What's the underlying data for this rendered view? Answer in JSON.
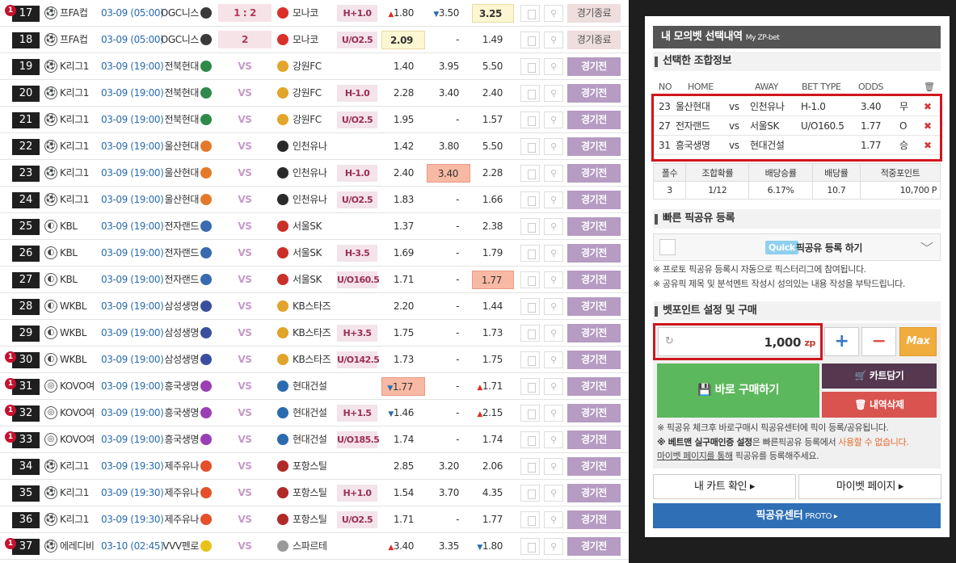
{
  "matches": [
    {
      "no": "17",
      "alert": "1",
      "league": "프FA컵",
      "ball": "⚽",
      "date": "03-09 (05:00)",
      "home": "OGC니스",
      "homeColor": "#3a3a3a",
      "score": "1 : 2",
      "scoreBox": true,
      "awayColor": "#d9302a",
      "away": "모나코",
      "type": "H+1.0",
      "o1": "1.80",
      "o1d": "up",
      "o1s": "",
      "o2": "3.50",
      "o2d": "down",
      "o2s": "",
      "o3": "3.25",
      "o3d": "",
      "o3s": "hi",
      "status": "경기종료",
      "statusType": "end"
    },
    {
      "no": "18",
      "alert": "",
      "league": "프FA컵",
      "ball": "⚽",
      "date": "03-09 (05:00)",
      "home": "OGC니스",
      "homeColor": "#3a3a3a",
      "score": "2",
      "scoreBox": true,
      "awayColor": "#d9302a",
      "away": "모나코",
      "type": "U/O2.5",
      "o1": "2.09",
      "o1d": "",
      "o1s": "hi",
      "o2": "-",
      "o2d": "",
      "o2s": "",
      "o3": "1.49",
      "o3d": "",
      "o3s": "",
      "status": "경기종료",
      "statusType": "end"
    },
    {
      "no": "19",
      "alert": "",
      "league": "K리그1",
      "ball": "⚽",
      "date": "03-09 (19:00)",
      "home": "전북현대",
      "homeColor": "#2f8a4a",
      "score": "VS",
      "scoreBox": false,
      "awayColor": "#e3a52a",
      "away": "강원FC",
      "type": "",
      "o1": "1.40",
      "o1d": "",
      "o1s": "",
      "o2": "3.95",
      "o2d": "",
      "o2s": "",
      "o3": "5.50",
      "o3d": "",
      "o3s": "",
      "status": "경기전",
      "statusType": "pre"
    },
    {
      "no": "20",
      "alert": "",
      "league": "K리그1",
      "ball": "⚽",
      "date": "03-09 (19:00)",
      "home": "전북현대",
      "homeColor": "#2f8a4a",
      "score": "VS",
      "scoreBox": false,
      "awayColor": "#e3a52a",
      "away": "강원FC",
      "type": "H-1.0",
      "o1": "2.28",
      "o1d": "",
      "o1s": "",
      "o2": "3.40",
      "o2d": "",
      "o2s": "",
      "o3": "2.40",
      "o3d": "",
      "o3s": "",
      "status": "경기전",
      "statusType": "pre"
    },
    {
      "no": "21",
      "alert": "",
      "league": "K리그1",
      "ball": "⚽",
      "date": "03-09 (19:00)",
      "home": "전북현대",
      "homeColor": "#2f8a4a",
      "score": "VS",
      "scoreBox": false,
      "awayColor": "#e3a52a",
      "away": "강원FC",
      "type": "U/O2.5",
      "o1": "1.95",
      "o1d": "",
      "o1s": "",
      "o2": "-",
      "o2d": "",
      "o2s": "",
      "o3": "1.57",
      "o3d": "",
      "o3s": "",
      "status": "경기전",
      "statusType": "pre"
    },
    {
      "no": "22",
      "alert": "",
      "league": "K리그1",
      "ball": "⚽",
      "date": "03-09 (19:00)",
      "home": "울산현대",
      "homeColor": "#e37a2a",
      "score": "VS",
      "scoreBox": false,
      "awayColor": "#2a2a2a",
      "away": "인천유나",
      "type": "",
      "o1": "1.42",
      "o1d": "",
      "o1s": "",
      "o2": "3.80",
      "o2d": "",
      "o2s": "",
      "o3": "5.50",
      "o3d": "",
      "o3s": "",
      "status": "경기전",
      "statusType": "pre"
    },
    {
      "no": "23",
      "alert": "",
      "league": "K리그1",
      "ball": "⚽",
      "date": "03-09 (19:00)",
      "home": "울산현대",
      "homeColor": "#e37a2a",
      "score": "VS",
      "scoreBox": false,
      "awayColor": "#2a2a2a",
      "away": "인천유나",
      "type": "H-1.0",
      "o1": "2.40",
      "o1d": "",
      "o1s": "",
      "o2": "3.40",
      "o2d": "",
      "o2s": "sel",
      "o3": "2.28",
      "o3d": "",
      "o3s": "",
      "status": "경기전",
      "statusType": "pre"
    },
    {
      "no": "24",
      "alert": "",
      "league": "K리그1",
      "ball": "⚽",
      "date": "03-09 (19:00)",
      "home": "울산현대",
      "homeColor": "#e37a2a",
      "score": "VS",
      "scoreBox": false,
      "awayColor": "#2a2a2a",
      "away": "인천유나",
      "type": "U/O2.5",
      "o1": "1.83",
      "o1d": "",
      "o1s": "",
      "o2": "-",
      "o2d": "",
      "o2s": "",
      "o3": "1.66",
      "o3d": "",
      "o3s": "",
      "status": "경기전",
      "statusType": "pre"
    },
    {
      "no": "25",
      "alert": "",
      "league": "KBL",
      "ball": "◐",
      "date": "03-09 (19:00)",
      "home": "전자랜드",
      "homeColor": "#3a6ab0",
      "score": "VS",
      "scoreBox": false,
      "awayColor": "#c9302a",
      "away": "서울SK",
      "type": "",
      "o1": "1.37",
      "o1d": "",
      "o1s": "",
      "o2": "-",
      "o2d": "",
      "o2s": "",
      "o3": "2.38",
      "o3d": "",
      "o3s": "",
      "status": "경기전",
      "statusType": "pre"
    },
    {
      "no": "26",
      "alert": "",
      "league": "KBL",
      "ball": "◐",
      "date": "03-09 (19:00)",
      "home": "전자랜드",
      "homeColor": "#3a6ab0",
      "score": "VS",
      "scoreBox": false,
      "awayColor": "#c9302a",
      "away": "서울SK",
      "type": "H-3.5",
      "o1": "1.69",
      "o1d": "",
      "o1s": "",
      "o2": "-",
      "o2d": "",
      "o2s": "",
      "o3": "1.79",
      "o3d": "",
      "o3s": "",
      "status": "경기전",
      "statusType": "pre"
    },
    {
      "no": "27",
      "alert": "",
      "league": "KBL",
      "ball": "◐",
      "date": "03-09 (19:00)",
      "home": "전자랜드",
      "homeColor": "#3a6ab0",
      "score": "VS",
      "scoreBox": false,
      "awayColor": "#c9302a",
      "away": "서울SK",
      "type": "U/O160.5",
      "o1": "1.71",
      "o1d": "",
      "o1s": "",
      "o2": "-",
      "o2d": "",
      "o2s": "",
      "o3": "1.77",
      "o3d": "",
      "o3s": "sel",
      "status": "경기전",
      "statusType": "pre"
    },
    {
      "no": "28",
      "alert": "",
      "league": "WKBL",
      "ball": "◐",
      "date": "03-09 (19:00)",
      "home": "삼성생명",
      "homeColor": "#3b4fa0",
      "score": "VS",
      "scoreBox": false,
      "awayColor": "#e2a32a",
      "away": "KB스타즈",
      "type": "",
      "o1": "2.20",
      "o1d": "",
      "o1s": "",
      "o2": "-",
      "o2d": "",
      "o2s": "",
      "o3": "1.44",
      "o3d": "",
      "o3s": "",
      "status": "경기전",
      "statusType": "pre"
    },
    {
      "no": "29",
      "alert": "",
      "league": "WKBL",
      "ball": "◐",
      "date": "03-09 (19:00)",
      "home": "삼성생명",
      "homeColor": "#3b4fa0",
      "score": "VS",
      "scoreBox": false,
      "awayColor": "#e2a32a",
      "away": "KB스타즈",
      "type": "H+3.5",
      "o1": "1.75",
      "o1d": "",
      "o1s": "",
      "o2": "-",
      "o2d": "",
      "o2s": "",
      "o3": "1.73",
      "o3d": "",
      "o3s": "",
      "status": "경기전",
      "statusType": "pre"
    },
    {
      "no": "30",
      "alert": "1",
      "league": "WKBL",
      "ball": "◐",
      "date": "03-09 (19:00)",
      "home": "삼성생명",
      "homeColor": "#3b4fa0",
      "score": "VS",
      "scoreBox": false,
      "awayColor": "#e2a32a",
      "away": "KB스타즈",
      "type": "U/O142.5",
      "o1": "1.73",
      "o1d": "",
      "o1s": "",
      "o2": "-",
      "o2d": "",
      "o2s": "",
      "o3": "1.75",
      "o3d": "",
      "o3s": "",
      "status": "경기전",
      "statusType": "pre"
    },
    {
      "no": "31",
      "alert": "1",
      "league": "KOVO여",
      "ball": "◎",
      "date": "03-09 (19:00)",
      "home": "흥국생명",
      "homeColor": "#9b3fb5",
      "score": "VS",
      "scoreBox": false,
      "awayColor": "#2a6bb0",
      "away": "현대건설",
      "type": "",
      "o1": "1.77",
      "o1d": "down",
      "o1s": "sel",
      "o2": "-",
      "o2d": "",
      "o2s": "",
      "o3": "1.71",
      "o3d": "up",
      "o3s": "",
      "status": "경기전",
      "statusType": "pre"
    },
    {
      "no": "32",
      "alert": "1",
      "league": "KOVO여",
      "ball": "◎",
      "date": "03-09 (19:00)",
      "home": "흥국생명",
      "homeColor": "#9b3fb5",
      "score": "VS",
      "scoreBox": false,
      "awayColor": "#2a6bb0",
      "away": "현대건설",
      "type": "H+1.5",
      "o1": "1.46",
      "o1d": "down",
      "o1s": "",
      "o2": "-",
      "o2d": "",
      "o2s": "",
      "o3": "2.15",
      "o3d": "up",
      "o3s": "",
      "status": "경기전",
      "statusType": "pre"
    },
    {
      "no": "33",
      "alert": "1",
      "league": "KOVO여",
      "ball": "◎",
      "date": "03-09 (19:00)",
      "home": "흥국생명",
      "homeColor": "#9b3fb5",
      "score": "VS",
      "scoreBox": false,
      "awayColor": "#2a6bb0",
      "away": "현대건설",
      "type": "U/O185.5",
      "o1": "1.74",
      "o1d": "",
      "o1s": "",
      "o2": "-",
      "o2d": "",
      "o2s": "",
      "o3": "1.74",
      "o3d": "",
      "o3s": "",
      "status": "경기전",
      "statusType": "pre"
    },
    {
      "no": "34",
      "alert": "",
      "league": "K리그1",
      "ball": "⚽",
      "date": "03-09 (19:30)",
      "home": "제주유나",
      "homeColor": "#e3502a",
      "score": "VS",
      "scoreBox": false,
      "awayColor": "#b02a2a",
      "away": "포항스틸",
      "type": "",
      "o1": "2.85",
      "o1d": "",
      "o1s": "",
      "o2": "3.20",
      "o2d": "",
      "o2s": "",
      "o3": "2.06",
      "o3d": "",
      "o3s": "",
      "status": "경기전",
      "statusType": "pre"
    },
    {
      "no": "35",
      "alert": "",
      "league": "K리그1",
      "ball": "⚽",
      "date": "03-09 (19:30)",
      "home": "제주유나",
      "homeColor": "#e3502a",
      "score": "VS",
      "scoreBox": false,
      "awayColor": "#b02a2a",
      "away": "포항스틸",
      "type": "H+1.0",
      "o1": "1.54",
      "o1d": "",
      "o1s": "",
      "o2": "3.70",
      "o2d": "",
      "o2s": "",
      "o3": "4.35",
      "o3d": "",
      "o3s": "",
      "status": "경기전",
      "statusType": "pre"
    },
    {
      "no": "36",
      "alert": "",
      "league": "K리그1",
      "ball": "⚽",
      "date": "03-09 (19:30)",
      "home": "제주유나",
      "homeColor": "#e3502a",
      "score": "VS",
      "scoreBox": false,
      "awayColor": "#b02a2a",
      "away": "포항스틸",
      "type": "U/O2.5",
      "o1": "1.71",
      "o1d": "",
      "o1s": "",
      "o2": "-",
      "o2d": "",
      "o2s": "",
      "o3": "1.77",
      "o3d": "",
      "o3s": "",
      "status": "경기전",
      "statusType": "pre"
    },
    {
      "no": "37",
      "alert": "1",
      "league": "에레디비",
      "ball": "⚽",
      "date": "03-10 (02:45)",
      "home": "VVV펜로",
      "homeColor": "#e8c21a",
      "score": "VS",
      "scoreBox": false,
      "awayColor": "#999999",
      "away": "스파르테",
      "type": "",
      "o1": "3.40",
      "o1d": "up",
      "o1s": "",
      "o2": "3.35",
      "o2d": "",
      "o2s": "",
      "o3": "1.80",
      "o3d": "down",
      "o3s": "",
      "status": "경기전",
      "statusType": "pre"
    }
  ],
  "panel": {
    "title": "내 모의벳 선택내역",
    "subtitle": "My ZP-bet",
    "combo_title": "선택한 조합정보",
    "headers": {
      "no": "NO",
      "home": "HOME",
      "away": "AWAY",
      "type": "BET TYPE",
      "odds": "ODDS"
    },
    "trash_icon": "🗑",
    "selections": [
      {
        "no": "23",
        "home": "울산현대",
        "vs": "vs",
        "away": "인천유나",
        "type": "H-1.0",
        "odds": "3.40",
        "pick": "무",
        "x": "✖"
      },
      {
        "no": "27",
        "home": "전자랜드",
        "vs": "vs",
        "away": "서울SK",
        "type": "U/O160.5",
        "odds": "1.77",
        "pick": "O",
        "x": "✖"
      },
      {
        "no": "31",
        "home": "흥국생명",
        "vs": "vs",
        "away": "현대건설",
        "type": "",
        "odds": "1.77",
        "pick": "승",
        "x": "✖"
      }
    ],
    "summary": {
      "h1": "폴수",
      "h2": "조합확률",
      "h3": "배당승률",
      "h4": "배당률",
      "h5": "적중포인트",
      "v1": "3",
      "v2": "1/12",
      "v3": "6.17%",
      "v4": "10.7",
      "v5": "10,700 P"
    },
    "quick_title": "빠른 픽공유 등록",
    "quick_badge": "Quick",
    "quick_text": "픽공유 등록 하기",
    "quick_note1": "※ 프로토 픽공유 등록시 자동으로 픽스터리그에 참여됩니다.",
    "quick_note2": "※ 공유픽 제목 및 분석멘트 작성시 성의있는 내용 작성을 부탁드립니다.",
    "bet_title": "벳포인트 설정 및 구매",
    "amount": "1,000",
    "unit": "zp",
    "plus": "+",
    "minus": "−",
    "max": "Max",
    "buy_label": "💾 바로 구매하기",
    "cart_label": "🛒 카트담기",
    "delete_label": "🗑 내역삭제",
    "buy_note1": "※ 픽공유 체크후 바로구매시 픽공유센터에 픽이 등록/공유됩니다.",
    "buy_note2a": "※ 베트맨 실구매인증 설정",
    "buy_note2b": "은 빠른픽공유 등록에서 ",
    "buy_note2c": "사용할 수 없습니다.",
    "buy_note3a": "마이벳 페이지를 통해",
    "buy_note3b": " 픽공유를 등록해주세요.",
    "cart_check": "내 카트 확인 ▸",
    "mybet": "마이벳 페이지 ▸",
    "pickcenter": "픽공유센터",
    "pickcenter_sub": "PROTO ▸"
  }
}
